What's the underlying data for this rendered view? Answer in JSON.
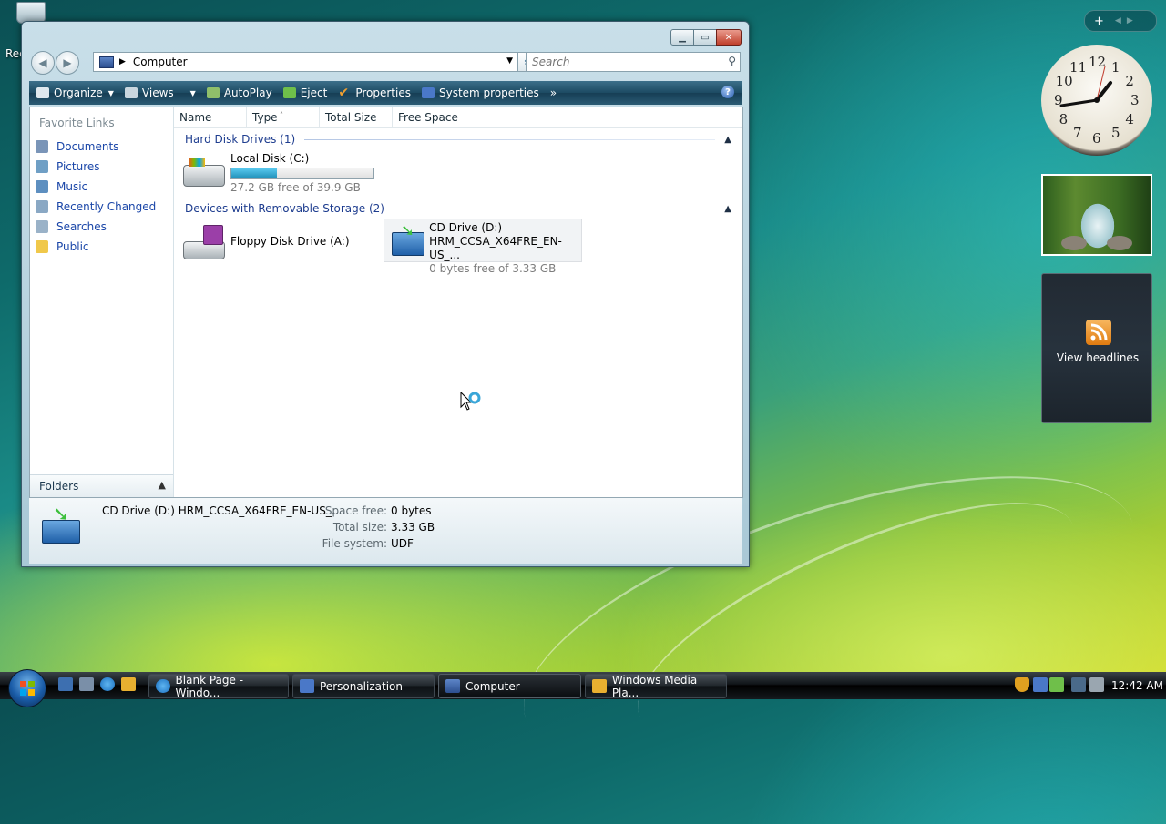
{
  "desktop": {
    "recycle_label": "Rec"
  },
  "window": {
    "address": {
      "location": "Computer"
    },
    "search": {
      "placeholder": "Search"
    },
    "toolbar": {
      "organize": "Organize",
      "views": "Views",
      "autoplay": "AutoPlay",
      "eject": "Eject",
      "properties": "Properties",
      "system_properties": "System properties"
    },
    "nav": {
      "favorite_links": "Favorite Links",
      "links": [
        "Documents",
        "Pictures",
        "Music",
        "Recently Changed",
        "Searches",
        "Public"
      ],
      "folders": "Folders"
    },
    "columns": [
      "Name",
      "Type",
      "Total Size",
      "Free Space"
    ],
    "groups": {
      "hard_disks": "Hard Disk Drives (1)",
      "removable": "Devices with Removable Storage (2)"
    },
    "drives": {
      "c": {
        "name": "Local Disk (C:)",
        "free_text": "27.2 GB free of 39.9 GB",
        "used_fraction": 0.32
      },
      "a": {
        "name": "Floppy Disk Drive (A:)"
      },
      "d": {
        "name": "CD Drive (D:)",
        "label": "HRM_CCSA_X64FRE_EN-US_...",
        "free_text": "0 bytes free of 3.33 GB"
      }
    },
    "details": {
      "title": "CD Drive (D:) HRM_CCSA_X64FRE_EN-US_...",
      "space_free_label": "Space free:",
      "space_free": "0 bytes",
      "total_size_label": "Total size:",
      "total_size": "3.33 GB",
      "file_system_label": "File system:",
      "file_system": "UDF"
    }
  },
  "sidebar": {
    "clock_numbers": [
      "12",
      "1",
      "2",
      "3",
      "4",
      "5",
      "6",
      "7",
      "8",
      "9",
      "10",
      "11"
    ],
    "feed_label": "View headlines"
  },
  "taskbar": {
    "tasks": [
      "Blank Page - Windo...",
      "Personalization",
      "Computer",
      "Windows Media Pla..."
    ],
    "time": "12:42 AM"
  },
  "colors": {
    "toolbar": "#1c4a62",
    "link": "#1a46a8",
    "group_header": "#1e3d8f",
    "progress": "#1f8fb8"
  }
}
